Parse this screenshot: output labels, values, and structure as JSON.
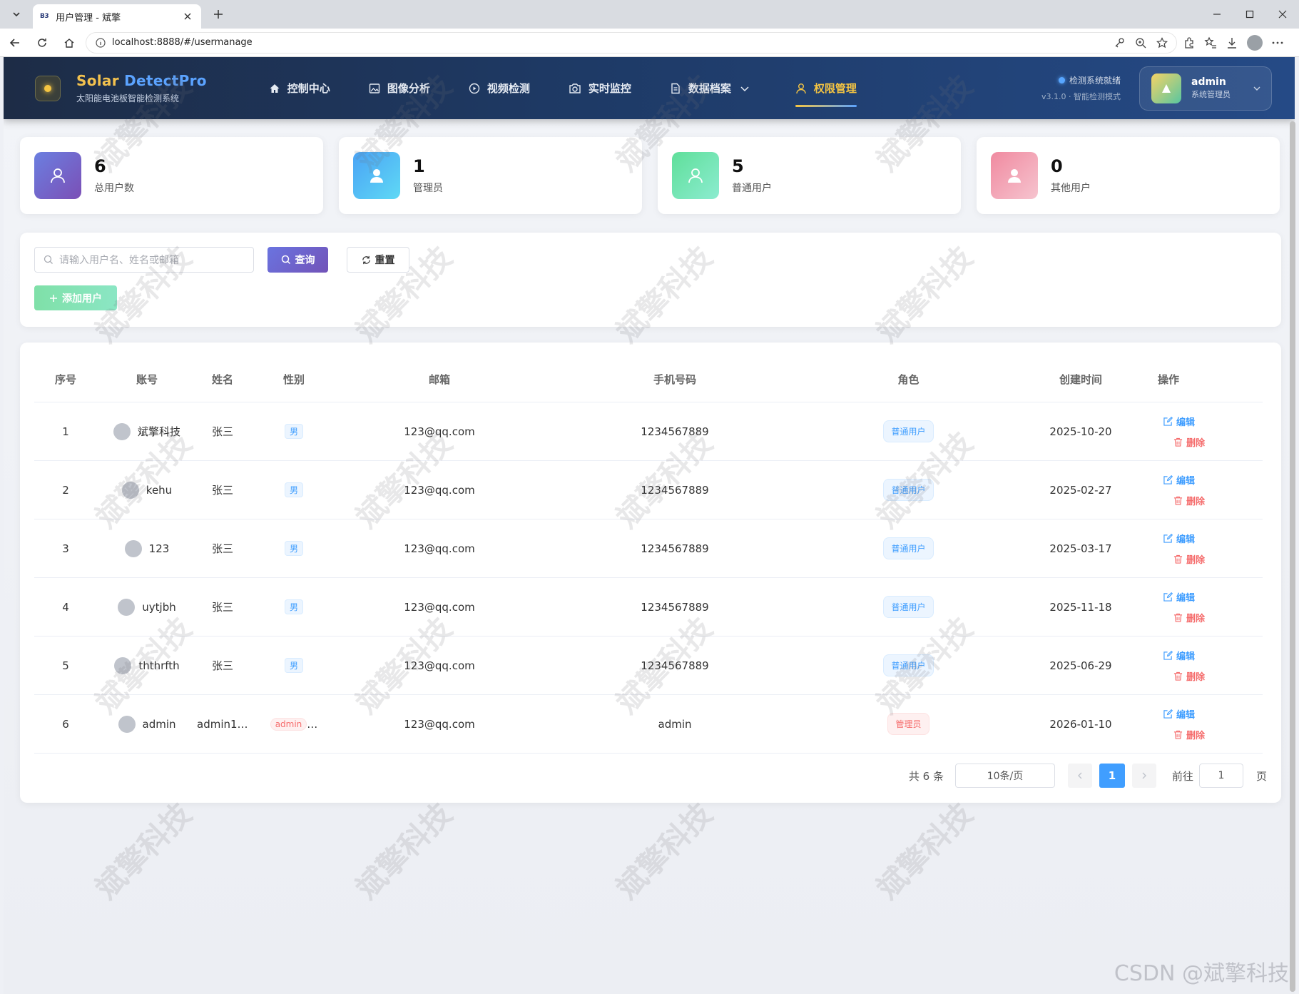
{
  "browser": {
    "tab_title": "用户管理 - 斌擎",
    "favicon_text": "B3",
    "url": "localhost:8888/#/usermanage"
  },
  "header": {
    "brand_part1": "Solar",
    "brand_part2": "DetectPro",
    "brand_sub": "太阳能电池板智能检测系统",
    "menu": [
      {
        "label": "控制中心",
        "icon": "home-icon"
      },
      {
        "label": "图像分析",
        "icon": "image-icon"
      },
      {
        "label": "视频检测",
        "icon": "play-icon"
      },
      {
        "label": "实时监控",
        "icon": "camera-icon"
      },
      {
        "label": "数据档案",
        "icon": "document-icon"
      },
      {
        "label": "权限管理",
        "icon": "user-icon",
        "active": true
      }
    ],
    "status": "检测系统就绪",
    "version": "v3.1.0 · 智能检测模式",
    "user_name": "admin",
    "user_role": "系统管理员"
  },
  "stats": [
    {
      "value": "6",
      "label": "总用户数",
      "color": "#7b5cc4"
    },
    {
      "value": "1",
      "label": "管理员",
      "color": "#4fa9f5"
    },
    {
      "value": "5",
      "label": "普通用户",
      "color": "#6ee0a4"
    },
    {
      "value": "0",
      "label": "其他用户",
      "color": "#f29aa8"
    }
  ],
  "search": {
    "placeholder": "请输入用户名、姓名或邮箱",
    "query_label": "查询",
    "reset_label": "重置",
    "add_label": "添加用户"
  },
  "table": {
    "headers": [
      "序号",
      "账号",
      "姓名",
      "性别",
      "邮箱",
      "手机号码",
      "角色",
      "创建时间",
      "操作"
    ],
    "edit_label": "编辑",
    "delete_label": "删除",
    "rows": [
      {
        "idx": "1",
        "account": "斌擎科技",
        "name": "张三",
        "gender": "男",
        "email": "123@qq.com",
        "phone": "1234567889",
        "role": "普通用户",
        "created": "2025-10-20"
      },
      {
        "idx": "2",
        "account": "kehu",
        "name": "张三",
        "gender": "男",
        "email": "123@qq.com",
        "phone": "1234567889",
        "role": "普通用户",
        "created": "2025-02-27"
      },
      {
        "idx": "3",
        "account": "123",
        "name": "张三",
        "gender": "男",
        "email": "123@qq.com",
        "phone": "1234567889",
        "role": "普通用户",
        "created": "2025-03-17"
      },
      {
        "idx": "4",
        "account": "uytjbh",
        "name": "张三",
        "gender": "男",
        "email": "123@qq.com",
        "phone": "1234567889",
        "role": "普通用户",
        "created": "2025-11-18"
      },
      {
        "idx": "5",
        "account": "ththrfth",
        "name": "张三",
        "gender": "男",
        "email": "123@qq.com",
        "phone": "1234567889",
        "role": "普通用户",
        "created": "2025-06-29"
      },
      {
        "idx": "6",
        "account": "admin",
        "name": "admin11...",
        "gender": "admin",
        "email": "123@qq.com",
        "phone": "admin",
        "role": "管理员",
        "created": "2026-01-10"
      }
    ]
  },
  "pagination": {
    "total": "共 6 条",
    "page_size": "10条/页",
    "current": "1",
    "goto_prefix": "前往",
    "goto_value": "1",
    "goto_suffix": "页"
  },
  "watermark": "斌擎科技",
  "footer_mark": "CSDN @斌擎科技"
}
